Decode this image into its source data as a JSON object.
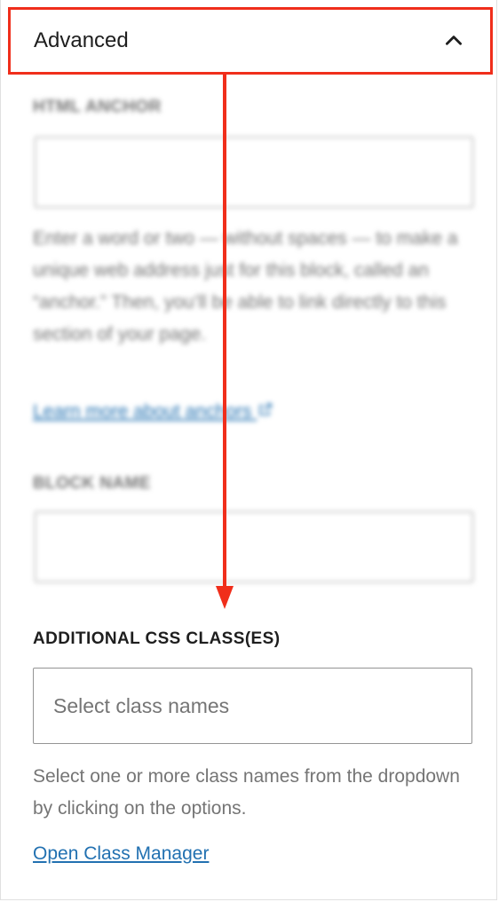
{
  "header": {
    "title": "Advanced"
  },
  "html_anchor": {
    "label": "HTML ANCHOR",
    "value": "",
    "help": "Enter a word or two — without spaces — to make a unique web address just for this block, called an “anchor.” Then, you’ll be able to link directly to this section of your page.",
    "link": "Learn more about anchors"
  },
  "block_name": {
    "label": "BLOCK NAME",
    "value": ""
  },
  "css_classes": {
    "label": "ADDITIONAL CSS CLASS(ES)",
    "placeholder": "Select class names",
    "help": "Select one or more class names from the dropdown by clicking on the options.",
    "link": "Open Class Manager"
  },
  "colors": {
    "highlight": "#f02e1b",
    "link": "#2271b1",
    "muted": "#757575",
    "border": "#949494"
  }
}
